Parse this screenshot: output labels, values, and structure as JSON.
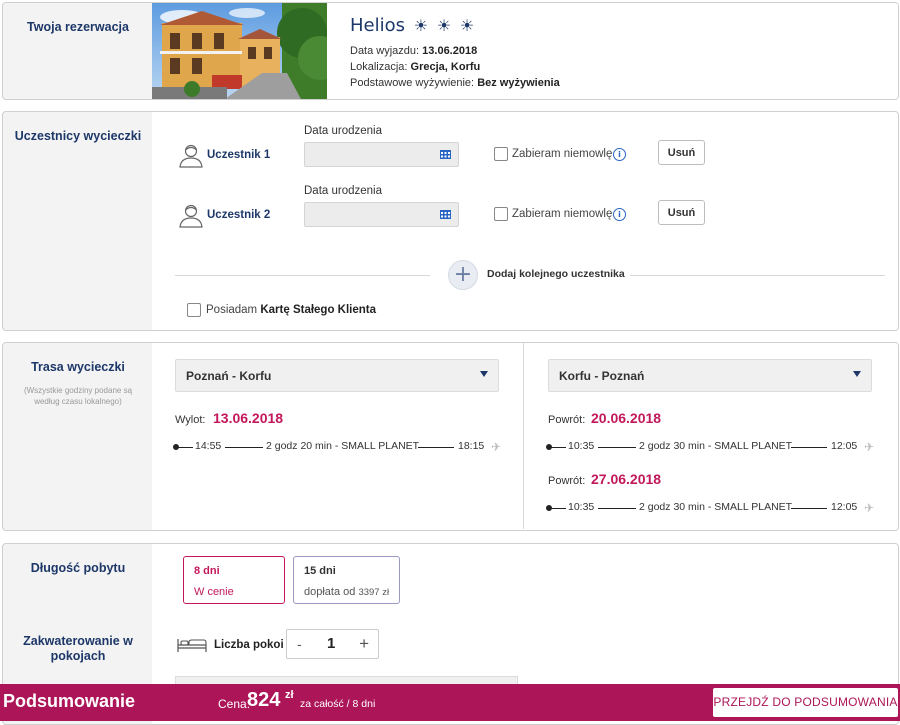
{
  "reservation": {
    "section_title": "Twoja rezerwacja",
    "hotel_name": "Helios",
    "sun_icon": "☀",
    "departure_label": "Data wyjazdu:",
    "departure_value": "13.06.2018",
    "location_label": "Lokalizacja:",
    "location_value": "Grecja, Korfu",
    "board_label": "Podstawowe wyżywienie:",
    "board_value": "Bez wyżywienia"
  },
  "participants": {
    "section_title": "Uczestnicy wycieczki",
    "items": [
      {
        "label": "Uczestnik 1",
        "dob_label": "Data urodzenia",
        "dob_value": "",
        "infant_label": "Zabieram niemowlę",
        "remove_label": "Usuń"
      },
      {
        "label": "Uczestnik 2",
        "dob_label": "Data urodzenia",
        "dob_value": "",
        "infant_label": "Zabieram niemowlę",
        "remove_label": "Usuń"
      }
    ],
    "add_label": "Dodaj kolejnego uczestnika",
    "loyalty_prefix": "Posiadam ",
    "loyalty_bold": "Kartę Stałego Klienta"
  },
  "route": {
    "section_title": "Trasa wycieczki",
    "section_subtitle": "(Wszystkie godziny podane są według czasu lokalnego)",
    "outbound": {
      "select_value": "Poznań - Korfu",
      "label": "Wylot:",
      "date": "13.06.2018",
      "flights": [
        {
          "dep": "14:55",
          "info": "2 godz 20 min - SMALL PLANET",
          "arr": "18:15"
        }
      ]
    },
    "return": {
      "select_value": "Korfu - Poznań",
      "options": [
        {
          "label": "Powrót:",
          "date": "20.06.2018",
          "flight": {
            "dep": "10:35",
            "info": "2 godz 30 min - SMALL PLANET",
            "arr": "12:05"
          }
        },
        {
          "label": "Powrót:",
          "date": "27.06.2018",
          "flight": {
            "dep": "10:35",
            "info": "2 godz 30 min - SMALL PLANET",
            "arr": "12:05"
          }
        }
      ]
    },
    "plane_icon": "✈"
  },
  "stay": {
    "section_title": "Długość pobytu",
    "options": [
      {
        "days": "8 dni",
        "price": "W cenie",
        "active": true
      },
      {
        "days": "15 dni",
        "price_prefix": "dopłata od ",
        "price_value": "3397 zł",
        "active": false
      }
    ]
  },
  "rooms": {
    "section_title": "Zakwaterowanie w pokojach",
    "label": "Liczba pokoi",
    "minus": "-",
    "value": "1",
    "plus": "+"
  },
  "footer": {
    "title": "Podsumowanie",
    "price_label": "Cena:",
    "price_value": "824",
    "price_currency": "zł",
    "price_note": "za całość / 8 dni",
    "button_label": "PRZEJDŹ DO PODSUMOWANIA"
  },
  "colors": {
    "accent": "#ac1557",
    "navy": "#1d3768",
    "highlight": "#c2185b"
  }
}
